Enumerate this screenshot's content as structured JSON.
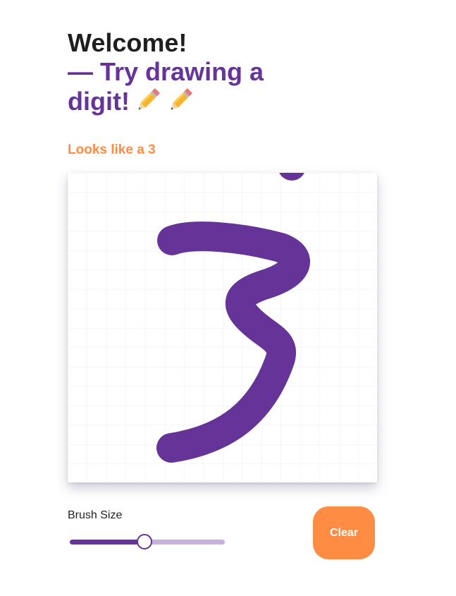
{
  "header": {
    "welcome": "Welcome!",
    "prompt": "— Try drawing a digit!",
    "icons": [
      "pencil-icon",
      "pencil-icon"
    ]
  },
  "prediction": {
    "text": "Looks like a 3",
    "color": "#ff8c42"
  },
  "canvas": {
    "stroke_color": "#663399",
    "grid": true
  },
  "controls": {
    "brush_label": "Brush Size",
    "brush_level": 0.48,
    "clear_label": "Clear"
  },
  "colors": {
    "primary": "#663399",
    "accent": "#ff8c42",
    "text": "#1f1f1f"
  }
}
